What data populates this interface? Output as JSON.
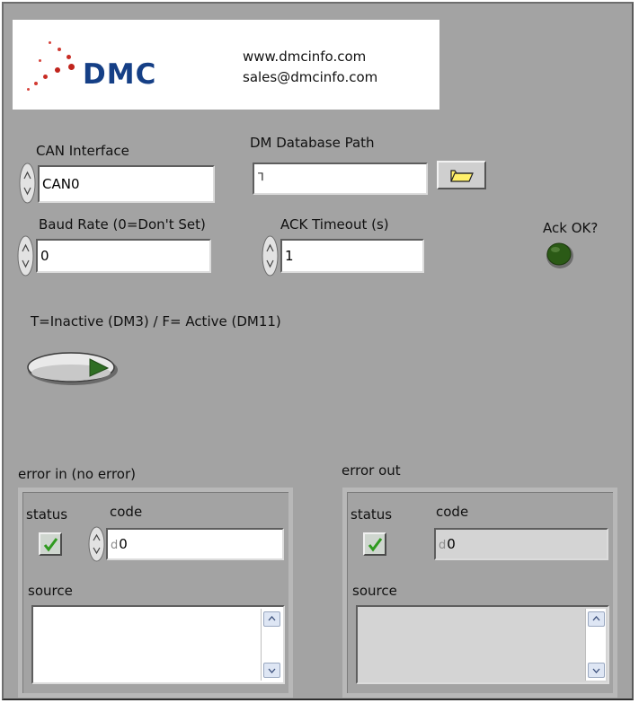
{
  "logo": {
    "brand": "DMC",
    "website": "www.dmcinfo.com",
    "email": "sales@dmcinfo.com"
  },
  "can_interface": {
    "label": "CAN Interface",
    "value": "CAN0"
  },
  "dm_database_path": {
    "label": "DM Database Path",
    "value": "",
    "icon": "path-icon",
    "browse_icon": "folder-open-icon"
  },
  "baud_rate": {
    "label": "Baud Rate (0=Don't Set)",
    "value": "0"
  },
  "ack_timeout": {
    "label": "ACK Timeout (s)",
    "value": "1"
  },
  "ack_ok": {
    "label": "Ack OK?",
    "state": false,
    "color": "#2b5a16"
  },
  "mode_switch": {
    "label": "T=Inactive (DM3) / F= Active (DM11)",
    "state": false
  },
  "error_in": {
    "title": "error in (no error)",
    "status_label": "status",
    "code_label": "code",
    "radix": "d",
    "code_value": "0",
    "status": false,
    "source_label": "source",
    "source_value": ""
  },
  "error_out": {
    "title": "error out",
    "status_label": "status",
    "code_label": "code",
    "radix": "d",
    "code_value": "0",
    "status": false,
    "source_label": "source",
    "source_value": ""
  },
  "colors": {
    "panel": "#a3a3a3",
    "brand": "#153f86",
    "logo_dots": "#c0241c",
    "check": "#2f9a1f"
  }
}
